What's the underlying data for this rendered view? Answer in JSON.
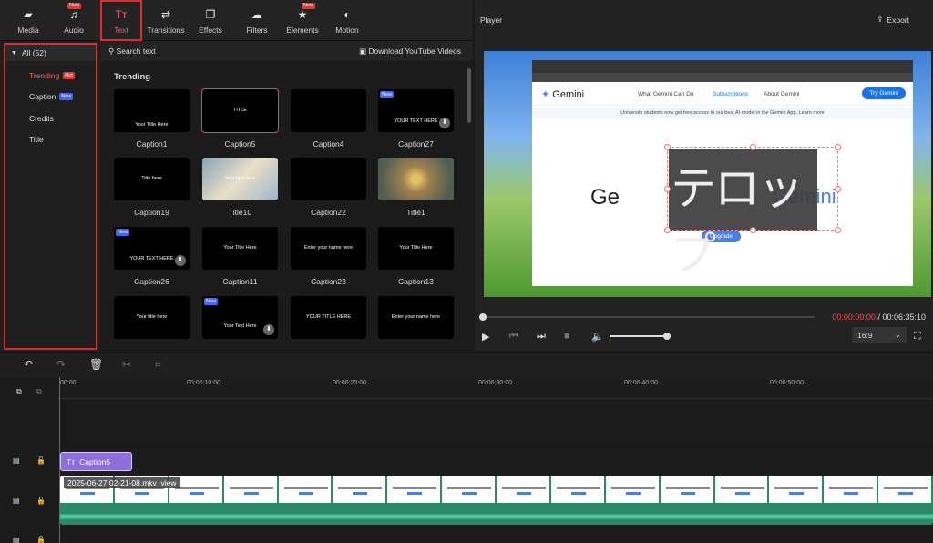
{
  "toolbar": {
    "tools": [
      {
        "label": "Media",
        "icon": "folder-icon"
      },
      {
        "label": "Audio",
        "icon": "music-note-icon",
        "badge": "New"
      },
      {
        "label": "Text",
        "icon": "text-icon",
        "active": true
      },
      {
        "label": "Transitions",
        "icon": "arrows-icon"
      },
      {
        "label": "Effects",
        "icon": "layers-icon"
      },
      {
        "label": "Filters",
        "icon": "cloud-icon"
      },
      {
        "label": "Elements",
        "icon": "sparkle-list-icon",
        "badge": "New"
      },
      {
        "label": "Motion",
        "icon": "motion-icon"
      }
    ]
  },
  "categories": {
    "all_label": "All (52)",
    "items": [
      {
        "label": "Trending",
        "tag": "Hot",
        "active": true
      },
      {
        "label": "Caption",
        "tag": "New"
      },
      {
        "label": "Credits"
      },
      {
        "label": "Title"
      }
    ]
  },
  "content": {
    "search_label": "Search text",
    "download_label": "Download YouTube Videos",
    "section_title": "Trending",
    "thumbnails": [
      {
        "label": "Caption1",
        "text": "Your Title Here"
      },
      {
        "label": "Caption5",
        "text": "TITLE"
      },
      {
        "label": "Caption4",
        "text": ""
      },
      {
        "label": "Caption27",
        "text": "YOUR TEXT HERE",
        "badge": "New"
      },
      {
        "label": "Caption19",
        "text": "Title here"
      },
      {
        "label": "Title10",
        "text": "Your text here"
      },
      {
        "label": "Caption22",
        "text": ""
      },
      {
        "label": "Title1",
        "text": ""
      },
      {
        "label": "Caption26",
        "text": "YOUR TEXT HERE",
        "badge": "New"
      },
      {
        "label": "Caption11",
        "text": "Your Title Here"
      },
      {
        "label": "Caption23",
        "text": "Enter your name here"
      },
      {
        "label": "Caption13",
        "text": "Your Title Here"
      },
      {
        "label": "",
        "text": "Your title here"
      },
      {
        "label": "",
        "text": "Your Text Here",
        "badge": "New"
      },
      {
        "label": "",
        "text": "YOUR TITLE HERE"
      },
      {
        "label": "",
        "text": "Enter your name here"
      }
    ]
  },
  "player": {
    "title": "Player",
    "export_label": "Export",
    "time_current": "00:00:00:00",
    "time_separator": " / ",
    "time_total": "00:06:35:10",
    "ratio": "16:9",
    "overlay_text": "テロップ",
    "progress": 0.0,
    "volume": 1.0
  },
  "gemini": {
    "logo": "Gemini",
    "nav1": "What Gemini Can Do",
    "nav2": "Subscriptions",
    "nav3": "About Gemini",
    "try": "Try Gemini",
    "notice": "University students now get free access to our best AI model in the Gemini App. Learn more",
    "big_left": "Ge",
    "big_right": "Gemini",
    "upgrade": "Upgrade"
  },
  "timeline": {
    "ticks": [
      "00:00",
      "00:00:10:00",
      "00:00:20:00",
      "00:00:30:00",
      "00:00:40:00",
      "00:00:50:00"
    ],
    "caption_clip": "Caption5",
    "video_clip": "2025-06-27 02-21-08.mkv_view",
    "frame_text": "Get more out of Gemini"
  }
}
